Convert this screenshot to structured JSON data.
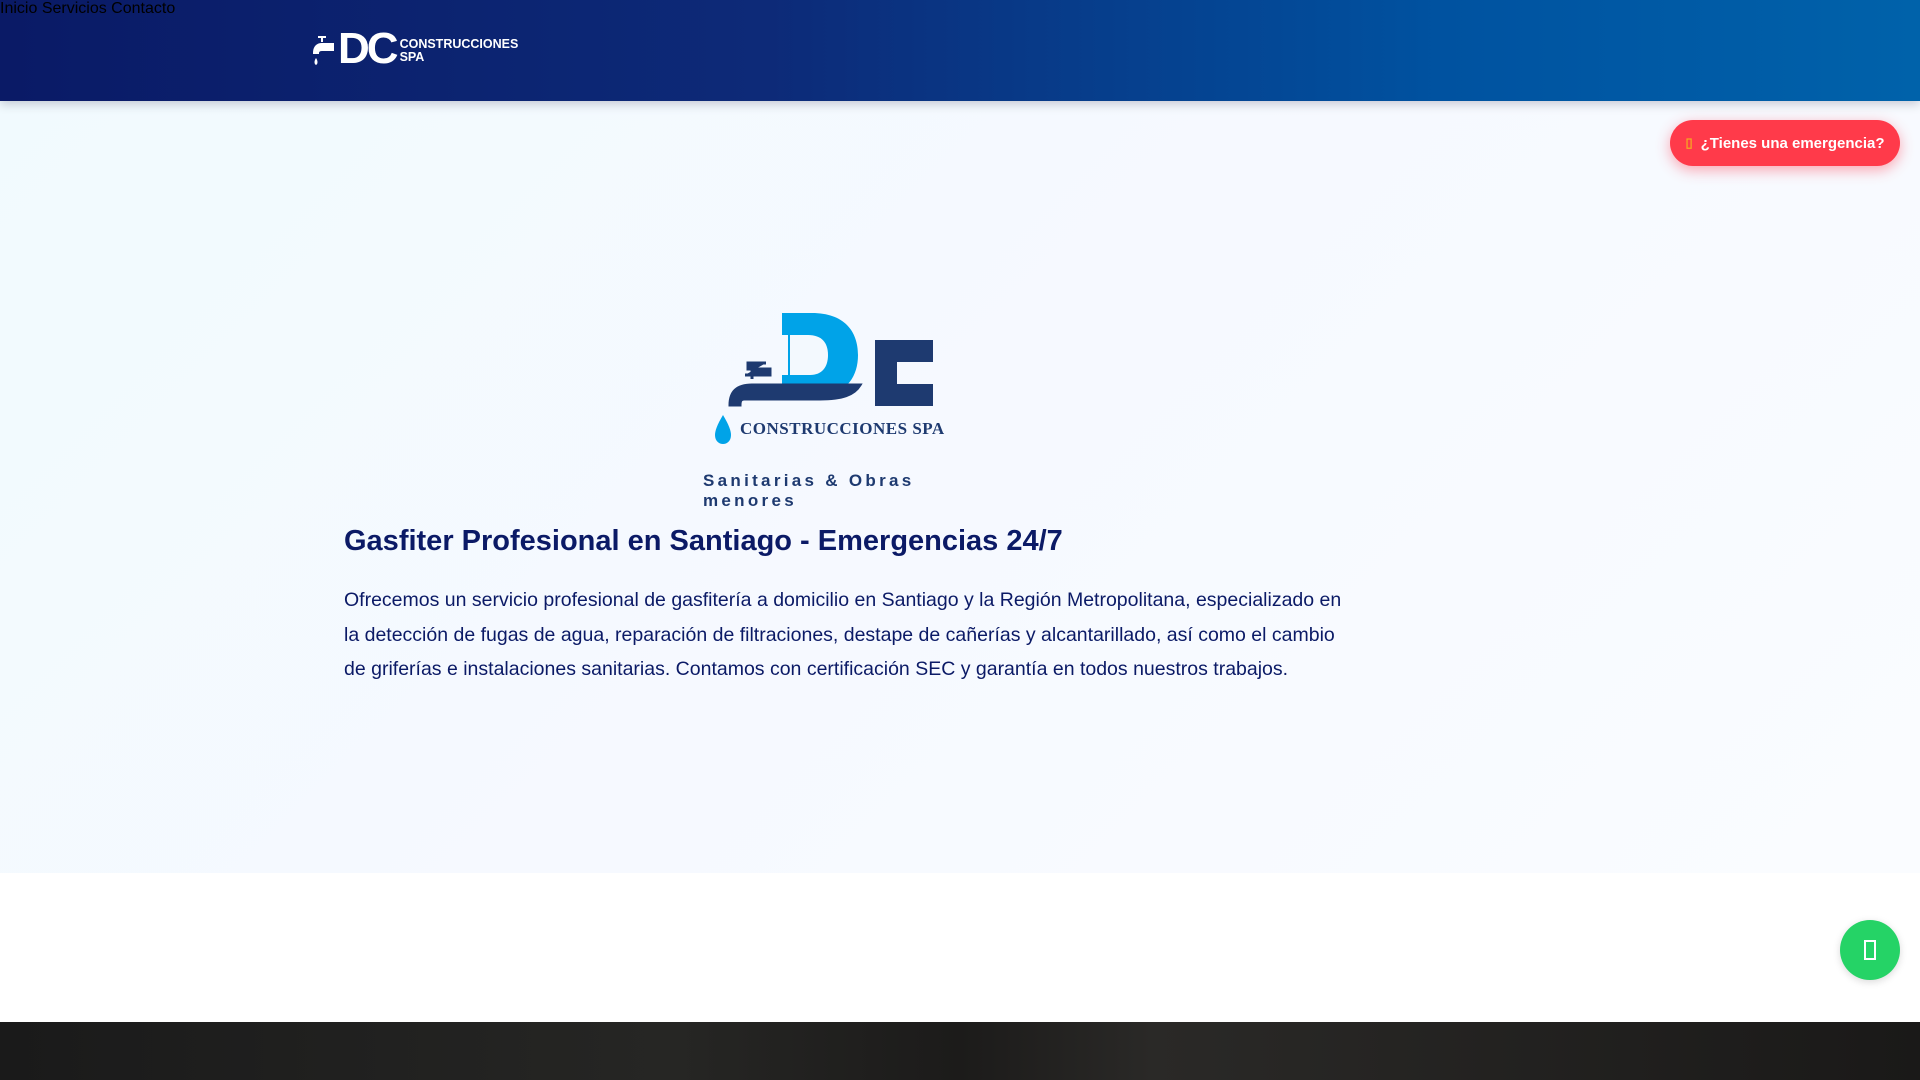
{
  "header": {
    "logo": {
      "mark": "DC",
      "line1": "CONSTRUCCIONES",
      "line2": "SPA"
    },
    "nav": [
      {
        "label": "Inicio"
      },
      {
        "label": "Servicios"
      },
      {
        "label": "Contacto"
      }
    ]
  },
  "emergency_button": {
    "label": "¿Tienes una emergencia?",
    "icon": "phone-icon"
  },
  "hero": {
    "logo": {
      "mark": "DC",
      "name": "CONSTRUCCIONES SPA",
      "tagline": "Sanitarias & Obras menores"
    },
    "title": "Gasfiter Profesional en Santiago - Emergencias 24/7",
    "description": "Ofrecemos un servicio profesional de gasfitería a domicilio en Santiago y la Región Metropolitana, especializado en la detección de fugas de agua, reparación de filtraciones, destape de cañerías y alcantarillado, así como el cambio de griferías e instalaciones sanitarias. Contamos con certificación SEC y garantía en todos nuestros trabajos."
  },
  "whatsapp_button": {
    "icon": "whatsapp-icon"
  },
  "colors": {
    "primary": "#0b1a66",
    "accent": "#00a3e8",
    "emergency": "#ff3a4a",
    "whatsapp": "#25d366"
  }
}
